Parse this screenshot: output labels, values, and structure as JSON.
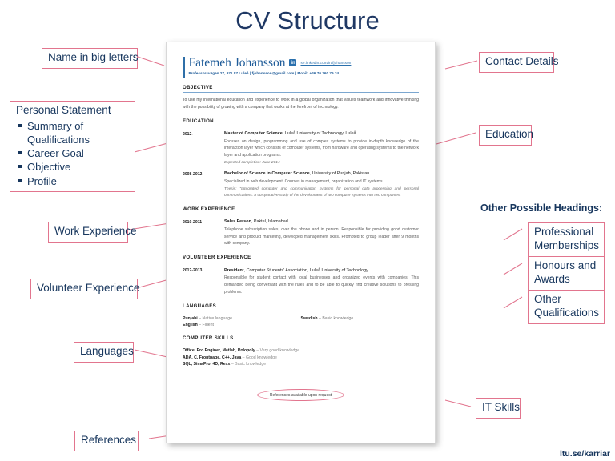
{
  "slide": {
    "title": "CV Structure",
    "footer": "ltu.se/karriar"
  },
  "annotations": {
    "name_big_letters": "Name in big letters",
    "personal_statement": {
      "headline": "Personal Statement",
      "items": [
        "Summary of Qualifications",
        "Career Goal",
        "Objective",
        "Profile"
      ]
    },
    "work_experience": "Work Experience",
    "volunteer_experience": "Volunteer  Experience",
    "languages": "Languages",
    "references": "References",
    "contact_details": "Contact Details",
    "education": "Education",
    "it_skills": "IT  Skills",
    "other_headings_title": "Other Possible Headings:",
    "other_headings": [
      "Professional Memberships",
      "Honours and Awards",
      "Other Qualifications"
    ]
  },
  "cv": {
    "name": "Fatemeh Johansson",
    "linkedin_icon_text": "in",
    "linkedin_url": "se.linkedin.com/in/fjohansson",
    "contact_line": "Professorsvägen 27, 971 87 Luleå | fjohansson@gmail.com | Mobil: +46 70 360 79 24",
    "sections": {
      "objective": {
        "title": "OBJECTIVE",
        "text": "To use my international education and experience to work in a global organization that values teamwork and innovative thinking with the possibility of growing with a company that works at the forefront of technology."
      },
      "education": {
        "title": "EDUCATION",
        "entries": [
          {
            "date": "2012-",
            "role": "Master of Computer Science",
            "org": ", Luleå University of Technology, Luleå",
            "desc": "Focuses on design, programming and use of complex systems to provide in-depth knowledge of the interaction layer which consists of computer systems, from hardware and operating systems to the network layer and application programs.",
            "italic": "Expected completion: June 2014"
          },
          {
            "date": "2008-2012",
            "role": "Bachelor of Science in Computer Science",
            "org": ", University of Punjab, Pakistan",
            "desc": "Specialized in web development. Courses in management, organization and IT systems.",
            "italic": "Thesis: \"Integrated computer and communication systems for personal data processing and personal communications. A comparative study of the development of two computer systems into two companies.\""
          }
        ]
      },
      "work_experience": {
        "title": "WORK EXPERIENCE",
        "entries": [
          {
            "date": "2010-2011",
            "role": "Sales Person",
            "org": ", Paktel, Islamabad",
            "desc": "Telephone subscription sales, over the phone and in person. Responsible for providing good customer service and product marketing, developed management skills. Promoted to group leader after 9 months with company.",
            "italic": ""
          }
        ]
      },
      "volunteer_experience": {
        "title": "VOLUNTEER EXPERIENCE",
        "entries": [
          {
            "date": "2012-2013",
            "role": "President",
            "org": ", Computer Students' Association, Luleå University of Technology",
            "desc": "Responsible for student contact with local businesses and organized events with companies. This demanded being conversant with the rules and to be able to quickly find creative solutions to pressing problems.",
            "italic": ""
          }
        ]
      },
      "languages": {
        "title": "LANGUAGES",
        "left": [
          {
            "name": "Punjabi",
            "level": " – Native language"
          },
          {
            "name": "English",
            "level": " – Fluent"
          }
        ],
        "right": [
          {
            "name": "Swedish",
            "level": " – Basic knowledge"
          }
        ]
      },
      "computer_skills": {
        "title": "COMPUTER SKILLS",
        "lines": [
          {
            "tools": "Office, Pro Enginer, Matlab, Polopoly",
            "level": " – Very good knowledge"
          },
          {
            "tools": "ADA, C, Frontpage, C++, Java",
            "level": " – Good knowledge"
          },
          {
            "tools": "SQL, SimaPro, 4D, Rexx",
            "level": " – Basic knowledge"
          }
        ]
      },
      "references": {
        "text": "References available upon request"
      }
    }
  },
  "colors": {
    "title_blue": "#1f3864",
    "callout_border": "#e2758e",
    "callout_text": "#17365d",
    "cv_accent": "#2f6fa8",
    "rule_blue": "#7ba7d0"
  }
}
